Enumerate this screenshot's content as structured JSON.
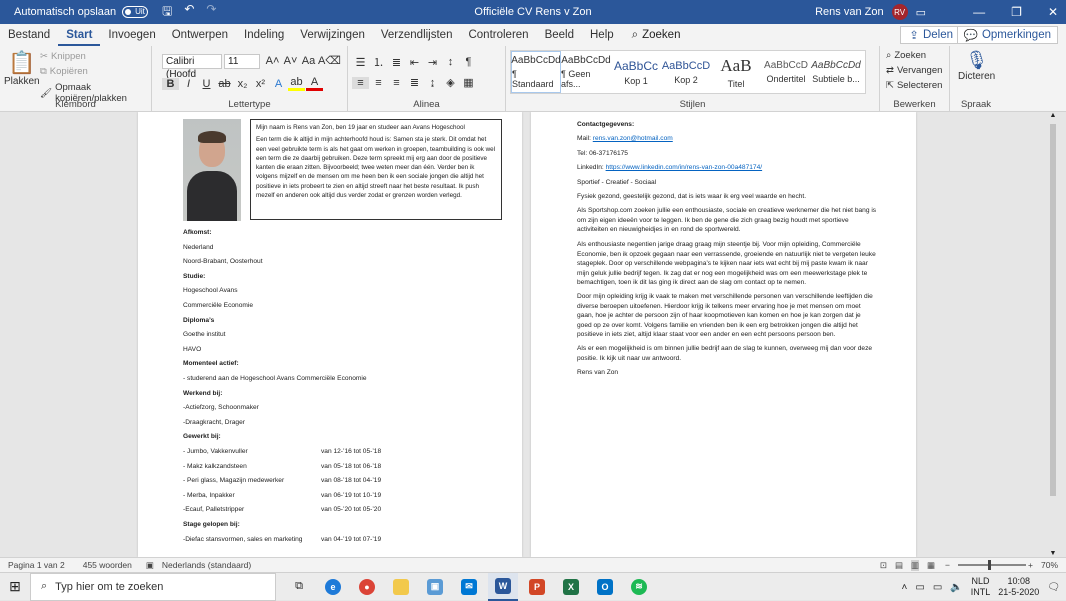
{
  "titlebar": {
    "autosave_label": "Automatisch opslaan",
    "autosave_state": "Uit",
    "doc_title": "Officiële CV Rens v Zon",
    "user_name": "Rens van Zon",
    "user_initials": "RV"
  },
  "tabs": [
    "Bestand",
    "Start",
    "Invoegen",
    "Ontwerpen",
    "Indeling",
    "Verwijzingen",
    "Verzendlijsten",
    "Controleren",
    "Beeld",
    "Help"
  ],
  "active_tab": "Start",
  "search_label": "Zoeken",
  "share_label": "Delen",
  "comments_label": "Opmerkingen",
  "ribbon": {
    "clipboard": {
      "label": "Klembord",
      "paste": "Plakken",
      "cut": "Knippen",
      "copy": "Kopiëren",
      "format_painter": "Opmaak kopiëren/plakken"
    },
    "font": {
      "label": "Lettertype",
      "font_name": "Calibri (Hoofd",
      "font_size": "11"
    },
    "paragraph": {
      "label": "Alinea"
    },
    "styles": {
      "label": "Stijlen",
      "items": [
        {
          "sample": "AaBbCcDd",
          "name": "¶ Standaard"
        },
        {
          "sample": "AaBbCcDd",
          "name": "¶ Geen afs..."
        },
        {
          "sample": "AaBbCc",
          "name": "Kop 1"
        },
        {
          "sample": "AaBbCcD",
          "name": "Kop 2"
        },
        {
          "sample": "AaB",
          "name": "Titel"
        },
        {
          "sample": "AaBbCcD",
          "name": "Ondertitel"
        },
        {
          "sample": "AaBbCcDd",
          "name": "Subtiele b..."
        }
      ]
    },
    "editing": {
      "label": "Bewerken",
      "find": "Zoeken",
      "replace": "Vervangen",
      "select": "Selecteren"
    },
    "voice": {
      "label": "Spraak",
      "dictate": "Dicteren"
    }
  },
  "page1": {
    "intro_line1": "Mijn naam is Rens van Zon, ben 19 jaar en studeer aan Avans Hogeschool",
    "intro_body": "Een term die ik altijd in mijn achterhoofd houd is: Samen sta je sterk. Dit omdat het een veel gebruikte term is als het gaat om werken in groepen, teambuilding is ook wel een term die ze daarbij gebruiken. Deze term spreekt mij erg aan door de positieve kanten die eraan zitten. Bijvoorbeeld; twee weten meer dan één. Verder ben ik volgens mijzelf en de mensen om me heen ben ik een sociale jongen die altijd het positieve in iets probeert te zien en altijd streeft naar het beste resultaat. Ik push mezelf en anderen ook altijd dus verder zodat er grenzen worden verlegd.",
    "lines": [
      {
        "text": "Afkomst:",
        "bold": true
      },
      {
        "text": "Nederland",
        "bold": false
      },
      {
        "text": "Noord-Brabant, Oosterhout",
        "bold": false
      },
      {
        "text": "Studie:",
        "bold": true
      },
      {
        "text": "Hogeschool Avans",
        "bold": false
      },
      {
        "text": "Commerciële Economie",
        "bold": false
      },
      {
        "text": "Diploma’s",
        "bold": true
      },
      {
        "text": "Goethe institut",
        "bold": false
      },
      {
        "text": "HAVO",
        "bold": false
      },
      {
        "text": "Momenteel actief:",
        "bold": true
      },
      {
        "text": "- studerend aan de Hogeschool Avans Commerciële Economie",
        "bold": false
      },
      {
        "text": "Werkend bij:",
        "bold": true
      },
      {
        "text": "-Actiefzorg, Schoonmaker",
        "bold": false
      },
      {
        "text": "-Draagkracht, Drager",
        "bold": false
      },
      {
        "text": "Gewerkt bij:",
        "bold": true
      },
      {
        "text": "- Jumbo, Vakkenvuller",
        "bold": false,
        "period": "van 12-’16 tot 05-’18"
      },
      {
        "text": "- Makz kalkzandsteen",
        "bold": false,
        "period": "van 05-’18 tot 06-’18"
      },
      {
        "text": "- Peri glass, Magazijn medewerker",
        "bold": false,
        "period": "van 08-’18 tot 04-’19"
      },
      {
        "text": "- Merba, Inpakker",
        "bold": false,
        "period": "van 06-’19 tot 10-’19"
      },
      {
        "text": "-Ecauf, Palletstripper",
        "bold": false,
        "period": "van 05-’20 tot 05-’20"
      },
      {
        "text": "Stage gelopen bij:",
        "bold": true
      },
      {
        "text": "-Diefac stansvormen, sales en marketing",
        "bold": false,
        "period": "van 04-’19 tot 07-’19"
      }
    ]
  },
  "page2": {
    "contact_heading": "Contactgegevens:",
    "mail_label": "Mail: ",
    "mail_value": "rens.van.zon@hotmail.com",
    "tel": "Tel: 06-37176175",
    "linkedin_label": "LinkedIn: ",
    "linkedin_value": "https://www.linkedin.com/in/rens-van-zon-00a487174/",
    "traits": "Sportief - Creatief - Sociaal",
    "health": "Fysiek gezond, geestelijk gezond, dat is iets waar ik erg veel waarde en hecht.",
    "para1": "Als Sportshop.com zoeken jullie een enthousiaste, sociale en creatieve werknemer die het niet bang is om zijn eigen ideeën voor te leggen. Ik ben de gene die zich graag bezig houdt met sportieve activiteiten en nieuwigheidjes in en rond de sportwereld.",
    "para2": "Als enthousiaste negentien jarige draag graag mijn steentje bij. Voor mijn opleiding, Commerciële Economie, ben ik opzoek gegaan naar een verrassende, groeiende en natuurlijk niet te vergeten leuke stageplek. Door op verschillende webpagina’s te kijken naar iets wat echt bij mij paste kwam ik naar mijn geluk jullie bedrijf tegen. Ik zag dat er nog een mogelijkheid was om een meewerkstage plek te bemachtigen, toen ik dit las ging ik direct aan de slag om contact op te nemen.",
    "para3": "Door mijn opleiding krijg ik vaak te maken met verschillende personen van verschillende leeftijden die diverse beroepen uitoefenen. Hierdoor krijg ik telkens meer ervaring hoe je met mensen om moet gaan, hoe je achter de persoon zijn of haar koopmotieven kan komen en hoe je kan zorgen dat je goed op ze over komt. Volgens familie en vrienden ben ik een erg betrokken jongen die altijd het positieve in iets ziet, altijd klaar staat voor een ander en een echt persoons persoon ben.",
    "para4": "Als er een mogelijkheid is om binnen jullie bedrijf aan de slag te kunnen, overweeg mij dan voor deze positie. Ik kijk uit naar uw antwoord.",
    "signature": "Rens van Zon"
  },
  "status": {
    "page": "Pagina 1 van 2",
    "words": "455 woorden",
    "language": "Nederlands (standaard)",
    "zoom": "70%"
  },
  "taskbar": {
    "search_placeholder": "Typ hier om te zoeken",
    "lang1": "NLD",
    "lang2": "INTL",
    "time": "10:08",
    "date": "21-5-2020"
  },
  "colors": {
    "word_blue": "#2b579a",
    "link": "#0563c1"
  }
}
